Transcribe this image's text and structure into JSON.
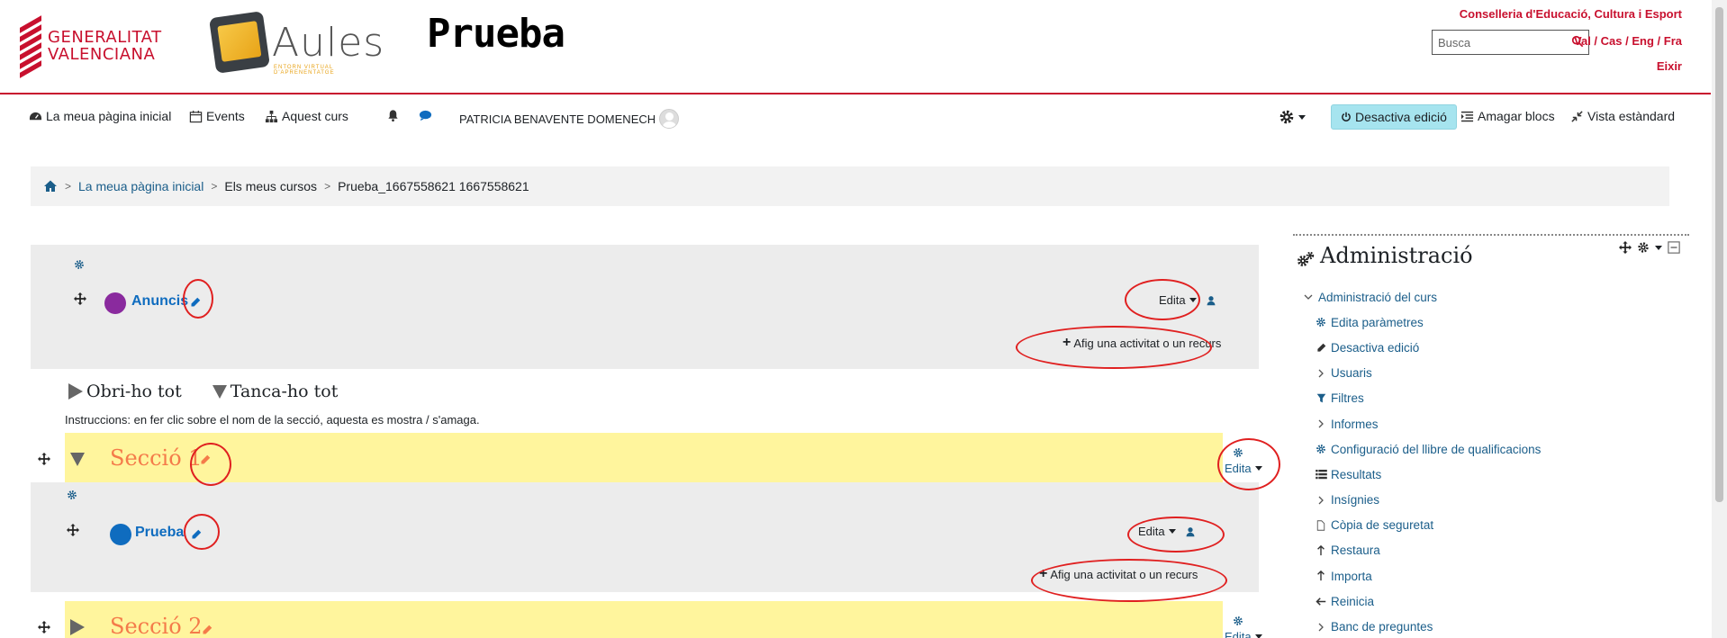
{
  "header": {
    "gva_logo_text": [
      "GENERALITAT",
      "VALENCIANA"
    ],
    "aules_logo_text": "Aules",
    "aules_logo_sub": "ENTORN VIRTUAL D'APRENENTATGE",
    "site_name": "Prueba",
    "conselleria": "Conselleria d'Educació, Cultura i Esport",
    "search_placeholder": "Busca",
    "languages": [
      "Val",
      "Cas",
      "Eng",
      "Fra"
    ],
    "logout": "Eixir"
  },
  "navbar": {
    "home": "La meua pàgina inicial",
    "events": "Events",
    "course": "Aquest curs",
    "user_name": "PATRICIA BENAVENTE DOMENECH",
    "edit_toggle": "Desactiva edició",
    "hide_blocks": "Amagar blocs",
    "standard_view": "Vista estàndard"
  },
  "breadcrumb": {
    "items": [
      "La meua pàgina inicial",
      "Els meus cursos",
      "Prueba_1667558621 1667558621"
    ]
  },
  "course": {
    "section0": {
      "activity": "Anuncis",
      "edit_label": "Edita",
      "add_activity": "Afig una activitat o un recurs"
    },
    "expand_all": "Obri-ho tot",
    "collapse_all": "Tanca-ho tot",
    "instructions": "Instruccions: en fer clic sobre el nom de la secció, aquesta es mostra / s'amaga.",
    "sections": [
      {
        "title": "Secció 1",
        "edit_label": "Edita",
        "activity": "Prueba",
        "activity_edit": "Edita",
        "add_activity": "Afig una activitat o un recurs"
      },
      {
        "title": "Secció 2",
        "edit_label": "Edita"
      }
    ]
  },
  "admin": {
    "title": "Administració",
    "items": [
      {
        "label": "Administració del curs",
        "icon": "chevron-down-icon",
        "kind": "top"
      },
      {
        "label": "Edita paràmetres",
        "icon": "gear-icon",
        "kind": "lvl"
      },
      {
        "label": "Desactiva edició",
        "icon": "pencil-icon",
        "kind": "lvl"
      },
      {
        "label": "Usuaris",
        "icon": "chevron-right-icon",
        "kind": "lvl"
      },
      {
        "label": "Filtres",
        "icon": "filter-icon",
        "kind": "lvl"
      },
      {
        "label": "Informes",
        "icon": "chevron-right-icon",
        "kind": "lvl"
      },
      {
        "label": "Configuració del llibre de qualificacions",
        "icon": "gear-icon",
        "kind": "lvl"
      },
      {
        "label": "Resultats",
        "icon": "list-icon",
        "kind": "lvl"
      },
      {
        "label": "Insígnies",
        "icon": "chevron-right-icon",
        "kind": "lvl"
      },
      {
        "label": "Còpia de seguretat",
        "icon": "file-icon",
        "kind": "lvl"
      },
      {
        "label": "Restaura",
        "icon": "upload-icon",
        "kind": "lvl"
      },
      {
        "label": "Importa",
        "icon": "upload-icon",
        "kind": "lvl"
      },
      {
        "label": "Reinicia",
        "icon": "arrow-left-icon",
        "kind": "lvl"
      },
      {
        "label": "Banc de preguntes",
        "icon": "chevron-right-icon",
        "kind": "lvl"
      }
    ]
  },
  "colors": {
    "brand_red": "#c8102e",
    "link_blue": "#0f6cbf",
    "section_highlight": "#fff59d",
    "section_title": "#f47b4a",
    "edit_button": "#a6e4ef",
    "annotation_red": "#e02020"
  }
}
